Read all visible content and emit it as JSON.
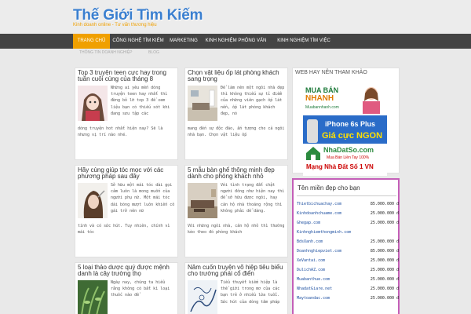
{
  "site": {
    "title": "Thế Giới Tìm Kiếm",
    "tagline": "Kinh doanh online - Tư vấn thương hiệu"
  },
  "nav": {
    "items": [
      "TRANG CHỦ",
      "CÔNG NGHỆ TÌM KIẾM",
      "MARKETING",
      "KINH NGHIỆM PHỎNG VẤN",
      "KINH NGHIỆM TÌM VIỆC"
    ],
    "sub_items": [
      "THÔNG TIN DOANH NGHIỆP",
      "BLOG"
    ]
  },
  "posts": [
    {
      "title": "Top 3 truyện teen cực hay trong tuần cuối cùng của tháng 8",
      "excerpt": "Những ai yêu mến dòng truyện teen hay nhất thì đừng bỏ lỡ top 3 đề xem liệu bạn có thiếu sót khi đang sưu tập các",
      "excerpt_full": "dòng truyện hot nhất hiện nay? Sẽ là nhưng vị trí nào nhé."
    },
    {
      "title": "Chọn vật liệu ốp lát phòng khách sang trọng",
      "excerpt": "Để làm nên một ngôi nhà đẹp thì không thiếu sự tỉ điểm của những viên gạch ốp lát nền, ốp lát phòng khách đẹp, nó",
      "excerpt_full": "mang đến sự độc đáo, ấn tượng cho cả ngôi nhà bạn. Chọn vật liệu ốp"
    },
    {
      "title": "Hãy cùng giúp tóc mọc với các phương pháp sau đây",
      "excerpt": "Sở hữu một mái tóc dài gọi cảm luôn là mong muốn của người phụ nữ. Một mái tóc dài bóng mượt luôn khiến cô gái trở nên nữ",
      "excerpt_full": "tính và có sức hút. Tuy nhiên, chính vì mái tóc"
    },
    {
      "title": "5 mẫu bàn ghế thông minh đẹp dành cho phòng khách nhỏ",
      "excerpt": "Với tình trạng đất chật người đông như hiện nay thì để sở hữu được ngôi, hay căn hộ nhà thoáng rộng thì không phải dễ dàng.",
      "excerpt_full": "Với những ngôi nhà, căn hộ nhỏ thì thường kèo theo đó phòng khách"
    },
    {
      "title": "5 loại thảo dược quý được mệnh danh là cây trường thọ",
      "excerpt": "Ngày nay, chúng ta hiểu rằng không có bất kì loại thuốc nào để",
      "excerpt_full": ""
    },
    {
      "title": "Năm cuốn truyện võ hiệp tiêu biểu cho trường phái cổ điển",
      "excerpt": "Tiểu thuyết kiếm hiệp là thể giới trong mơ của các bạn trẻ ở nhiều lứa tuổi. Sức hút của dòng tâm pháp",
      "excerpt_full": ""
    }
  ],
  "sidebar": {
    "web_title": "WEB HAY NÊN THAM KHẢO",
    "ads": [
      {
        "line1": "MUA BÁN",
        "line2": "NHANH",
        "sub": "Muabannhanh.com"
      },
      {
        "line1": "iPhone 6s Plus",
        "line2": "Giá cực NGON",
        "sub": ""
      },
      {
        "line1": "NhaDatSo.com",
        "line2": "Mạng Nhà Đất Số 1 VN",
        "sub": "Mua Bán Liền Tay 100%"
      }
    ],
    "domains_title": "Tên miền đẹp cho bạn",
    "domains": [
      {
        "name": "Thietbichuachay.com",
        "price": "85.000.000 đ"
      },
      {
        "name": "Kinhdoanhchuame.com",
        "price": "25.000.000 đ"
      },
      {
        "name": "Ghegap.com",
        "price": "25.000.000 đ"
      },
      {
        "name": "Kinhnghiemthongminh.com",
        "price": ""
      },
      {
        "name": "BdsXanh.com",
        "price": "25.000.000 đ"
      },
      {
        "name": "Doanhnghiepviet.com",
        "price": "85.000.000 đ"
      },
      {
        "name": "XeVantai.com",
        "price": "25.000.000 đ"
      },
      {
        "name": "DulichAZ.com",
        "price": "25.000.000 đ"
      },
      {
        "name": "Muabanthue.com",
        "price": "25.000.000 đ"
      },
      {
        "name": "NhadatGiare.net",
        "price": "25.000.000 đ"
      },
      {
        "name": "Maytoandac.com",
        "price": "25.000.000 đ"
      }
    ]
  },
  "colors": {
    "accent": "#f0a000",
    "nav_bg": "#444444",
    "title_blue": "#3a7fd0",
    "domain_border": "#c45fb8",
    "domain_link": "#1d4fa0"
  },
  "icons": [
    "anime-girl-thumb",
    "living-room-thumb",
    "hair-care-thumb",
    "sofa-thumb",
    "herb-thumb",
    "ink-drawing-thumb"
  ]
}
